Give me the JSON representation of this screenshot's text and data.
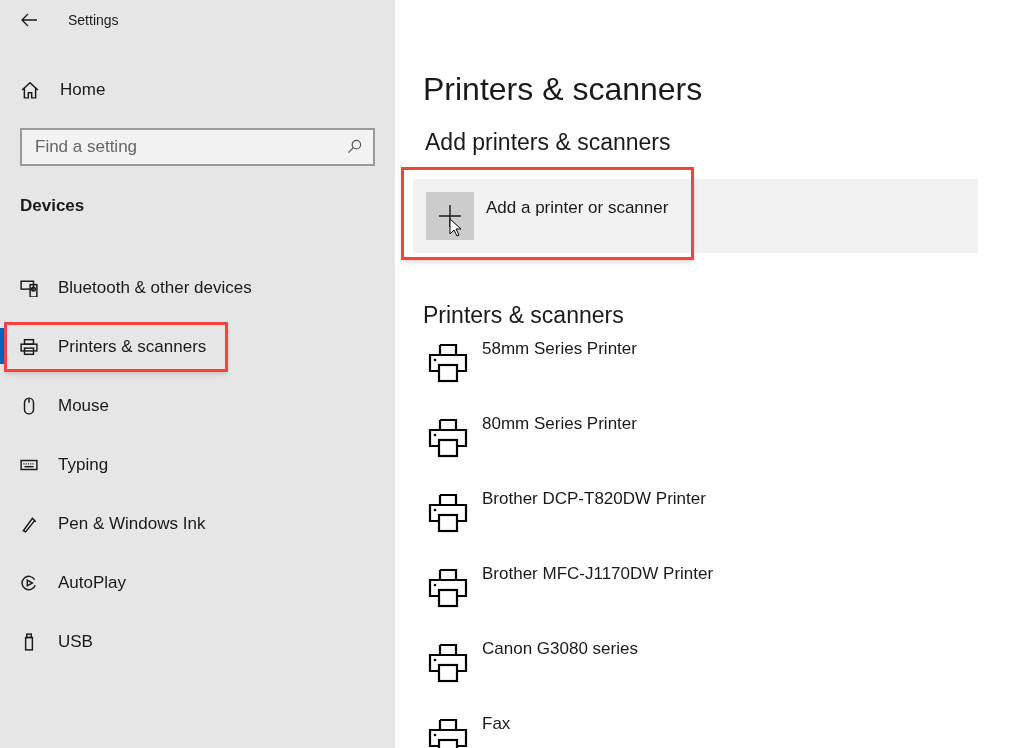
{
  "window": {
    "title": "Settings"
  },
  "sidebar": {
    "home": "Home",
    "search": {
      "placeholder": "Find a setting"
    },
    "section": "Devices",
    "items": [
      {
        "label": "Bluetooth & other devices",
        "kind": "bluetooth",
        "selected": false,
        "highlighted": false
      },
      {
        "label": "Printers & scanners",
        "kind": "printer",
        "selected": true,
        "highlighted": true
      },
      {
        "label": "Mouse",
        "kind": "mouse",
        "selected": false,
        "highlighted": false
      },
      {
        "label": "Typing",
        "kind": "keyboard",
        "selected": false,
        "highlighted": false
      },
      {
        "label": "Pen & Windows Ink",
        "kind": "pen",
        "selected": false,
        "highlighted": false
      },
      {
        "label": "AutoPlay",
        "kind": "autoplay",
        "selected": false,
        "highlighted": false
      },
      {
        "label": "USB",
        "kind": "usb",
        "selected": false,
        "highlighted": false
      }
    ]
  },
  "main": {
    "title": "Printers & scanners",
    "add_heading": "Add printers & scanners",
    "add_button": {
      "label": "Add a printer or scanner",
      "highlighted": true
    },
    "list_heading": "Printers & scanners",
    "printers": [
      "58mm Series Printer",
      "80mm Series Printer",
      "Brother DCP-T820DW Printer",
      "Brother MFC-J1170DW Printer",
      "Canon G3080 series",
      "Fax"
    ]
  }
}
